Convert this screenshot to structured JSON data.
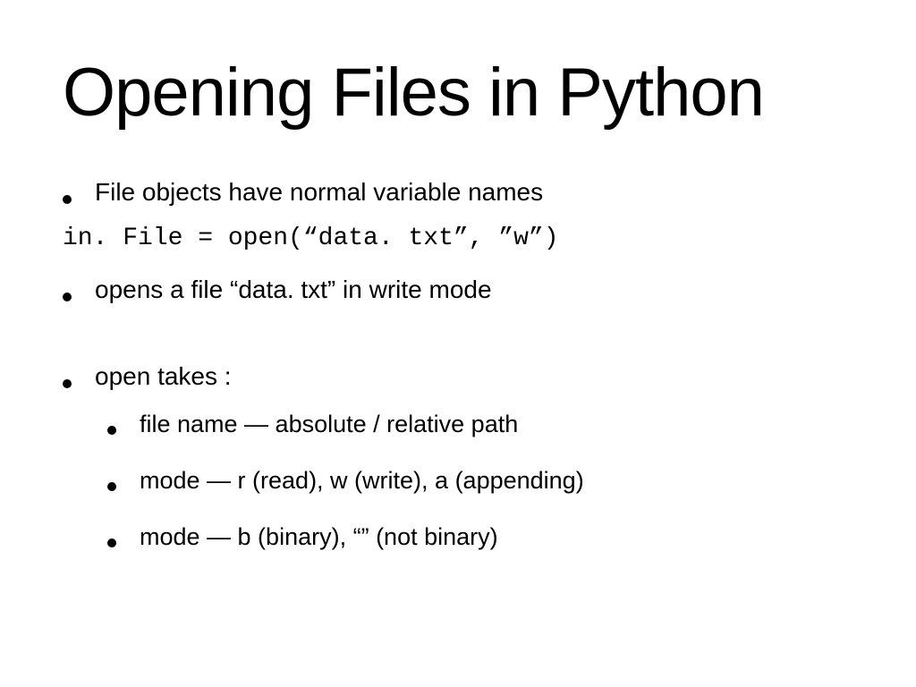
{
  "slide": {
    "title": "Opening Files in Python",
    "bullets": {
      "b1": "File objects have normal variable names",
      "code": "in. File = open(“data. txt”, ”w”)",
      "b2": "opens a file “data. txt” in write mode",
      "b3": "open takes :",
      "sub": {
        "s1": "file name — absolute / relative path",
        "s2": "mode — r (read), w (write), a (appending)",
        "s3": "mode — b (binary), “” (not binary)"
      }
    }
  }
}
